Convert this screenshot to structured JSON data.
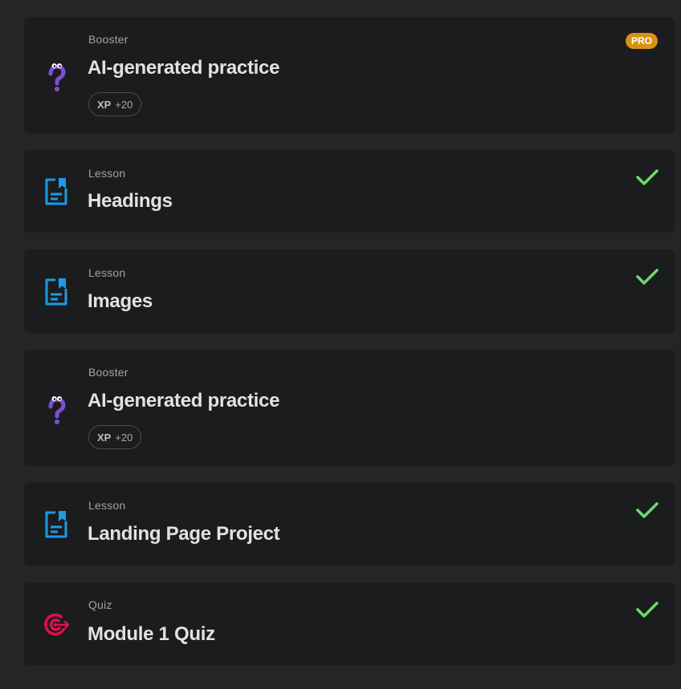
{
  "items": [
    {
      "type": "Booster",
      "title": "AI-generated practice",
      "xp_label": "XP",
      "xp_value": "+20",
      "badge": "PRO",
      "icon": "question-mascot-icon"
    },
    {
      "type": "Lesson",
      "title": "Headings",
      "completed": true,
      "icon": "lesson-document-icon"
    },
    {
      "type": "Lesson",
      "title": "Images",
      "completed": true,
      "icon": "lesson-document-icon"
    },
    {
      "type": "Booster",
      "title": "AI-generated practice",
      "xp_label": "XP",
      "xp_value": "+20",
      "icon": "question-mascot-icon"
    },
    {
      "type": "Lesson",
      "title": "Landing Page Project",
      "completed": true,
      "icon": "lesson-document-icon"
    },
    {
      "type": "Quiz",
      "title": "Module 1 Quiz",
      "completed": true,
      "icon": "quiz-target-icon"
    }
  ],
  "colors": {
    "background": "#242527",
    "card": "#1b1c1e",
    "lesson_icon": "#1c9be6",
    "booster_icon": "#7f4fd1",
    "quiz_icon": "#e0104d",
    "check": "#6ed96a",
    "pro_badge": "#d99112"
  }
}
